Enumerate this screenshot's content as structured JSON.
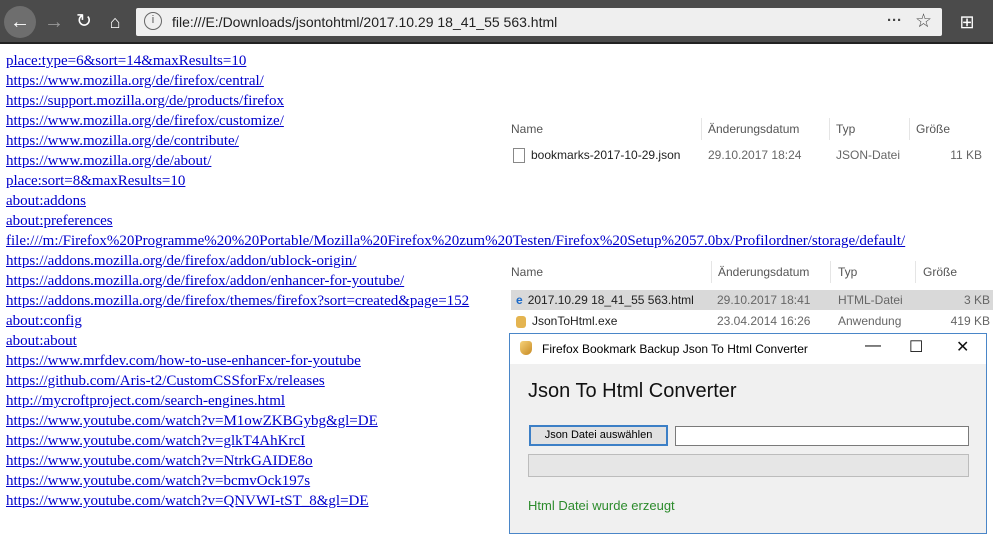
{
  "browser": {
    "url": "file:///E:/Downloads/jsontohtml/2017.10.29 18_41_55 563.html",
    "icons": [
      "back-icon",
      "forward-icon",
      "reload-icon",
      "home-icon",
      "info-icon",
      "more-icon",
      "star-icon",
      "new-tab-icon"
    ]
  },
  "links": [
    "place:type=6&sort=14&maxResults=10",
    "https://www.mozilla.org/de/firefox/central/",
    "https://support.mozilla.org/de/products/firefox",
    "https://www.mozilla.org/de/firefox/customize/",
    "https://www.mozilla.org/de/contribute/",
    "https://www.mozilla.org/de/about/",
    "place:sort=8&maxResults=10",
    "about:addons",
    "about:preferences",
    "file:///m:/Firefox%20Programme%20%20Portable/Mozilla%20Firefox%20zum%20Testen/Firefox%20Setup%2057.0bx/Profilordner/storage/default/",
    "https://addons.mozilla.org/de/firefox/addon/ublock-origin/",
    "https://addons.mozilla.org/de/firefox/addon/enhancer-for-youtube/",
    "https://addons.mozilla.org/de/firefox/themes/firefox?sort=created&page=152",
    "about:config",
    "about:about",
    "https://www.mrfdev.com/how-to-use-enhancer-for-youtube",
    "https://github.com/Aris-t2/CustomCSSforFx/releases",
    "http://mycroftproject.com/search-engines.html",
    "https://www.youtube.com/watch?v=M1owZKBGybg&gl=DE",
    "https://www.youtube.com/watch?v=glkT4AhKrcI",
    "https://www.youtube.com/watch?v=NtrkGAIDE8o",
    "https://www.youtube.com/watch?v=bcmvOck197s",
    "https://www.youtube.com/watch?v=QNVWI-tST_8&gl=DE"
  ],
  "explorer1": {
    "headers": {
      "name": "Name",
      "date": "Änderungsdatum",
      "type": "Typ",
      "size": "Größe"
    },
    "rows": [
      {
        "name": "bookmarks-2017-10-29.json",
        "date": "29.10.2017 18:24",
        "type": "JSON-Datei",
        "size": "11 KB"
      }
    ]
  },
  "explorer2": {
    "headers": {
      "name": "Name",
      "date": "Änderungsdatum",
      "type": "Typ",
      "size": "Größe"
    },
    "rows": [
      {
        "name": "2017.10.29 18_41_55 563.html",
        "date": "29.10.2017 18:41",
        "type": "HTML-Datei",
        "size": "3 KB"
      },
      {
        "name": "JsonToHtml.exe",
        "date": "23.04.2014 16:26",
        "type": "Anwendung",
        "size": "419 KB"
      }
    ]
  },
  "dialog": {
    "title": "Firefox Bookmark Backup Json To Html Converter",
    "heading": "Json To Html Converter",
    "button": "Json Datei auswählen",
    "path_value": "",
    "progress": 0,
    "status": "Html Datei wurde erzeugt",
    "status_color": "#2c8b2c"
  }
}
